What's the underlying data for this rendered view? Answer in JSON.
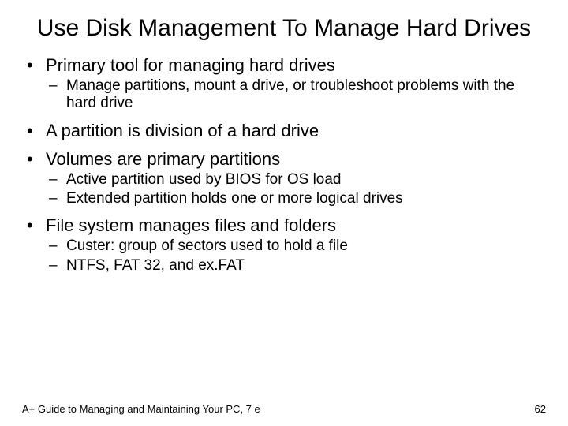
{
  "title": "Use Disk Management To Manage Hard Drives",
  "bullets": [
    {
      "text": "Primary tool for managing hard drives",
      "sub": [
        "Manage partitions, mount a drive, or troubleshoot problems with the hard drive"
      ]
    },
    {
      "text": "A partition is division of a hard drive",
      "sub": []
    },
    {
      "text": "Volumes are primary partitions",
      "sub": [
        "Active partition used by BIOS for OS load",
        "Extended partition holds one or more logical drives"
      ]
    },
    {
      "text": "File system manages files and folders",
      "sub": [
        "Custer: group of sectors used to hold a file",
        "NTFS, FAT 32, and ex.FAT"
      ]
    }
  ],
  "footer": {
    "left": "A+ Guide to Managing and Maintaining Your PC, 7 e",
    "right": "62"
  }
}
